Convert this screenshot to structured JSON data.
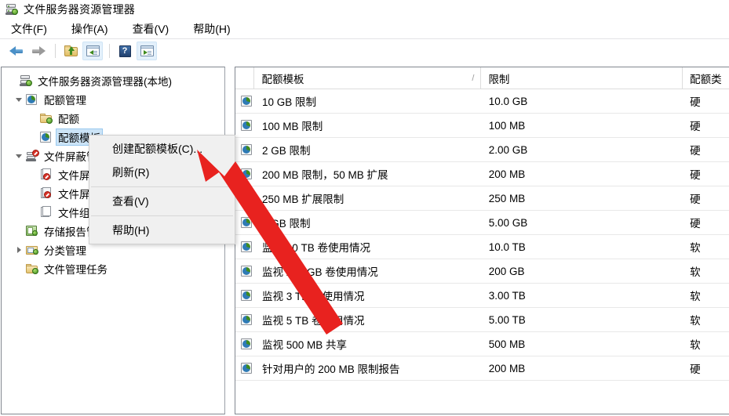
{
  "window": {
    "title": "文件服务器资源管理器",
    "icon": "server-icon"
  },
  "menubar": {
    "items": [
      {
        "label": "文件(F)",
        "name": "menu-file"
      },
      {
        "label": "操作(A)",
        "name": "menu-action"
      },
      {
        "label": "查看(V)",
        "name": "menu-view"
      },
      {
        "label": "帮助(H)",
        "name": "menu-help"
      }
    ]
  },
  "toolbar": {
    "buttons": [
      {
        "name": "back-button",
        "icon": "back-arrow-icon",
        "label": ""
      },
      {
        "name": "forward-button",
        "icon": "forward-arrow-icon",
        "label": ""
      },
      {
        "name": "up-one-level-button",
        "icon": "folder-up-icon",
        "label": ""
      },
      {
        "name": "show-hide-tree-button",
        "icon": "window-pane-left-icon",
        "label": ""
      },
      {
        "name": "help-button",
        "icon": "question-mark-icon",
        "label": "?"
      },
      {
        "name": "show-hide-action-pane-button",
        "icon": "window-pane-right-icon",
        "label": ""
      }
    ]
  },
  "tree": {
    "items": [
      {
        "label": "文件服务器资源管理器(本地)",
        "icon": "server-icon",
        "depth": 0,
        "twisty": "none",
        "selected": false,
        "name": "tree-item-fsrm-local"
      },
      {
        "label": "配额管理",
        "icon": "quota-icon",
        "depth": 1,
        "twisty": "down",
        "selected": false,
        "name": "tree-item-quota-management"
      },
      {
        "label": "配额",
        "icon": "folder-green-icon",
        "depth": 2,
        "twisty": "none",
        "selected": false,
        "name": "tree-item-quotas"
      },
      {
        "label": "配额模板",
        "icon": "quota-template-icon",
        "depth": 2,
        "twisty": "none",
        "selected": true,
        "name": "tree-item-quota-templates"
      },
      {
        "label": "文件屏蔽管理",
        "icon": "file-screen-icon",
        "depth": 1,
        "twisty": "down",
        "selected": false,
        "name": "tree-item-file-screening-management"
      },
      {
        "label": "文件屏蔽",
        "icon": "file-screen-deny-icon",
        "depth": 2,
        "twisty": "none",
        "selected": false,
        "name": "tree-item-file-screens"
      },
      {
        "label": "文件屏蔽模板",
        "icon": "file-screen-template-icon",
        "depth": 2,
        "twisty": "none",
        "selected": false,
        "name": "tree-item-file-screen-templates"
      },
      {
        "label": "文件组",
        "icon": "file-group-icon",
        "depth": 2,
        "twisty": "none",
        "selected": false,
        "name": "tree-item-file-groups"
      },
      {
        "label": "存储报告管理",
        "icon": "storage-report-icon",
        "depth": 1,
        "twisty": "none",
        "selected": false,
        "name": "tree-item-storage-reports-management"
      },
      {
        "label": "分类管理",
        "icon": "classification-icon",
        "depth": 1,
        "twisty": "right",
        "selected": false,
        "name": "tree-item-classification-management"
      },
      {
        "label": "文件管理任务",
        "icon": "folder-green-icon",
        "depth": 1,
        "twisty": "none",
        "selected": false,
        "name": "tree-item-file-management-tasks"
      }
    ]
  },
  "listview": {
    "columns": [
      {
        "label": "配额模板",
        "sorted": true,
        "sort_indicator": "/",
        "name": "column-header-quota-template"
      },
      {
        "label": "限制",
        "sorted": false,
        "sort_indicator": "",
        "name": "column-header-limit"
      },
      {
        "label": "配额类",
        "sorted": false,
        "sort_indicator": "",
        "name": "column-header-quota-type"
      }
    ],
    "rows": [
      {
        "template": "10 GB 限制",
        "limit": "10.0 GB",
        "type": "硬"
      },
      {
        "template": "100 MB 限制",
        "limit": "100 MB",
        "type": "硬"
      },
      {
        "template": "2 GB 限制",
        "limit": "2.00 GB",
        "type": "硬"
      },
      {
        "template": "200 MB 限制，50 MB 扩展",
        "limit": "200 MB",
        "type": "硬"
      },
      {
        "template": "250 MB 扩展限制",
        "limit": "250 MB",
        "type": "硬"
      },
      {
        "template": "5 GB 限制",
        "limit": "5.00 GB",
        "type": "硬"
      },
      {
        "template": "监视 10 TB 卷使用情况",
        "limit": "10.0 TB",
        "type": "软"
      },
      {
        "template": "监视 200 GB 卷使用情况",
        "limit": "200 GB",
        "type": "软"
      },
      {
        "template": "监视 3 TB 卷使用情况",
        "limit": "3.00 TB",
        "type": "软"
      },
      {
        "template": "监视 5 TB 卷使用情况",
        "limit": "5.00 TB",
        "type": "软"
      },
      {
        "template": "监视 500 MB 共享",
        "limit": "500 MB",
        "type": "软"
      },
      {
        "template": "针对用户的 200 MB 限制报告",
        "limit": "200 MB",
        "type": "硬"
      }
    ],
    "row_icon": "quota-template-icon"
  },
  "context_menu": {
    "items": [
      {
        "type": "item",
        "label": "创建配额模板(C)...",
        "name": "context-menu-create-quota-template"
      },
      {
        "type": "item",
        "label": "刷新(R)",
        "name": "context-menu-refresh"
      },
      {
        "type": "separator"
      },
      {
        "type": "item",
        "label": "查看(V)",
        "name": "context-menu-view"
      },
      {
        "type": "separator"
      },
      {
        "type": "item",
        "label": "帮助(H)",
        "name": "context-menu-help"
      }
    ]
  },
  "annotation": {
    "arrow_color": "#e8221f",
    "arrow_target": "创建配额模板(C)..."
  },
  "colors": {
    "selection": "#cce4f7",
    "menu_background": "#f0f0f0",
    "pane_border": "#828790",
    "toolbar_highlight": "#e3f0fb"
  }
}
